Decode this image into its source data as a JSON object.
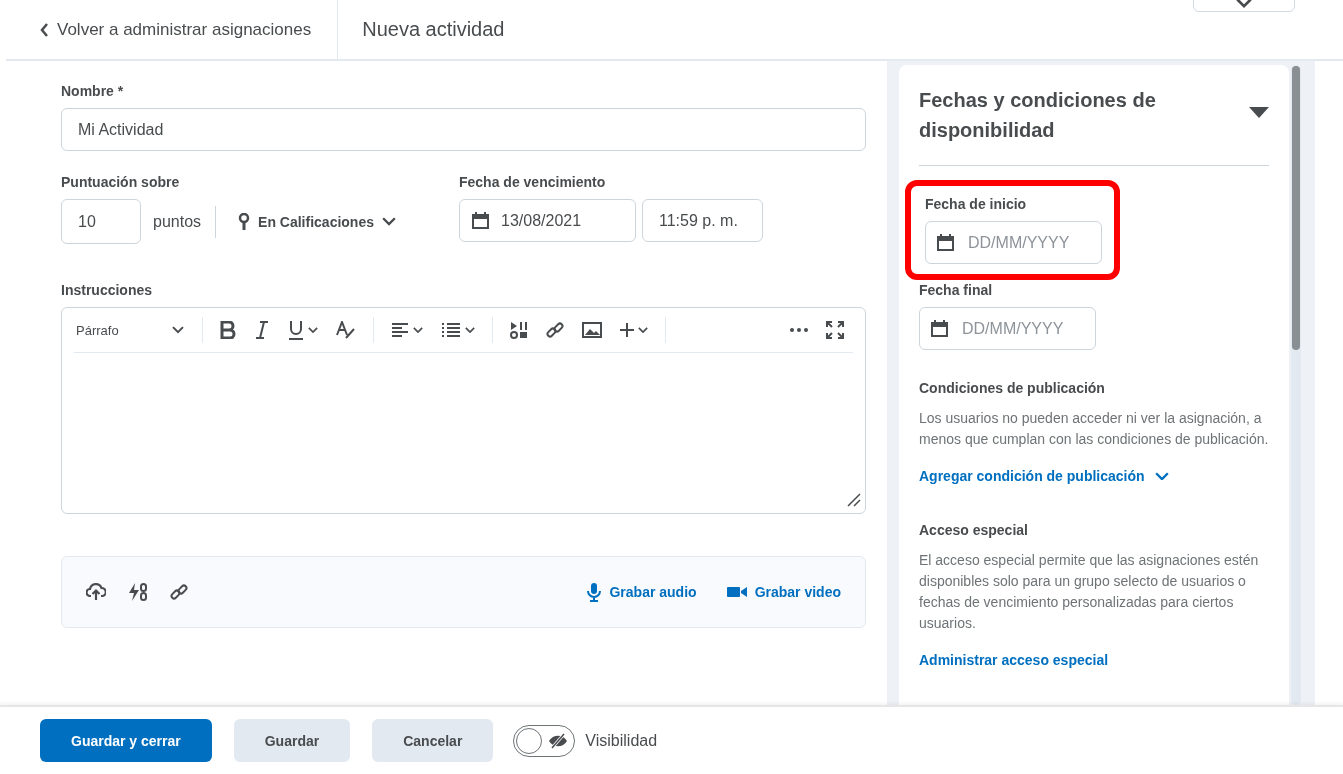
{
  "header": {
    "back_link": "Volver a administrar asignaciones",
    "title": "Nueva actividad"
  },
  "form": {
    "name": {
      "label": "Nombre *",
      "value": "Mi Actividad"
    },
    "score": {
      "label": "Puntuación sobre",
      "value": "10",
      "unit": "puntos",
      "gradebook": "En Calificaciones"
    },
    "due": {
      "label": "Fecha de vencimiento",
      "date": "13/08/2021",
      "time": "11:59 p. m."
    },
    "instructions": {
      "label": "Instrucciones",
      "format": "Párrafo"
    },
    "attachments": {
      "actions": [
        {
          "label": "Grabar audio",
          "kind": "audio"
        },
        {
          "label": "Grabar video",
          "kind": "video"
        }
      ]
    }
  },
  "availability": {
    "title": "Fechas y condiciones de disponibilidad",
    "expanded": true,
    "start": {
      "label": "Fecha de inicio",
      "placeholder": "DD/MM/YYYY",
      "highlighted": true
    },
    "end": {
      "label": "Fecha final",
      "placeholder": "DD/MM/YYYY",
      "highlighted": false
    },
    "release": {
      "heading": "Condiciones de publicación",
      "text": "Los usuarios no pueden acceder ni ver la asignación, a menos que cumplan con las condiciones de publicación.",
      "link": "Agregar condición de publicación"
    },
    "special": {
      "heading": "Acceso especial",
      "text": "El acceso especial permite que las asignaciones estén disponibles solo para un grupo selecto de usuarios o fechas de vencimiento personalizadas para ciertos usuarios.",
      "link": "Administrar acceso especial"
    }
  },
  "footer": {
    "buttons": [
      {
        "label": "Guardar y cerrar",
        "kind": "primary"
      },
      {
        "label": "Guardar",
        "kind": "secondary"
      },
      {
        "label": "Cancelar",
        "kind": "secondary"
      }
    ],
    "visibility": {
      "label": "Visibilidad",
      "on": false
    }
  }
}
